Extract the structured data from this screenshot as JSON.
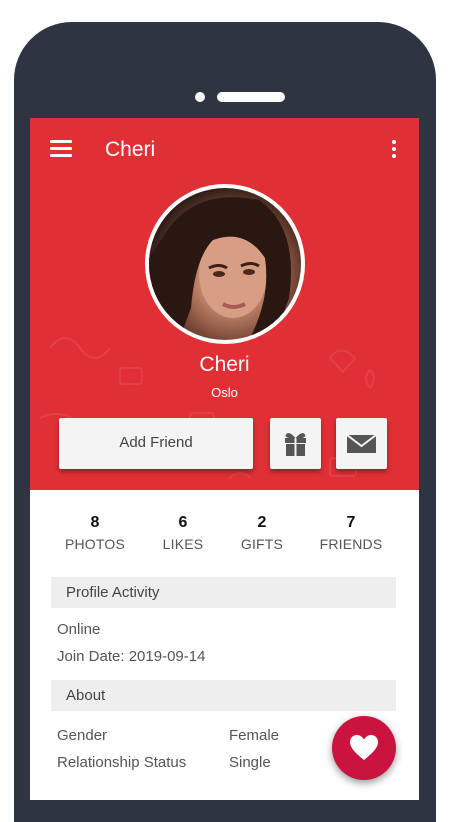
{
  "app_bar": {
    "title": "Cheri"
  },
  "profile": {
    "name": "Cheri",
    "location": "Oslo"
  },
  "actions": {
    "add_friend_label": "Add Friend"
  },
  "stats": [
    {
      "value": "8",
      "label": "PHOTOS"
    },
    {
      "value": "6",
      "label": "LIKES"
    },
    {
      "value": "2",
      "label": "GIFTS"
    },
    {
      "value": "7",
      "label": "FRIENDS"
    }
  ],
  "profile_activity": {
    "heading": "Profile Activity",
    "status": "Online",
    "join_date": "Join Date: 2019-09-14"
  },
  "about": {
    "heading": "About",
    "rows": [
      {
        "label": "Gender",
        "value": "Female"
      },
      {
        "label": "Relationship Status",
        "value": "Single"
      }
    ]
  },
  "icons": {
    "menu": "hamburger-menu-icon",
    "more": "more-vertical-icon",
    "gift": "gift-icon",
    "message": "envelope-icon",
    "like": "heart-icon"
  },
  "colors": {
    "header_red": "#e03036",
    "fab_red": "#c8143f",
    "section_gray": "#eeeeee"
  }
}
